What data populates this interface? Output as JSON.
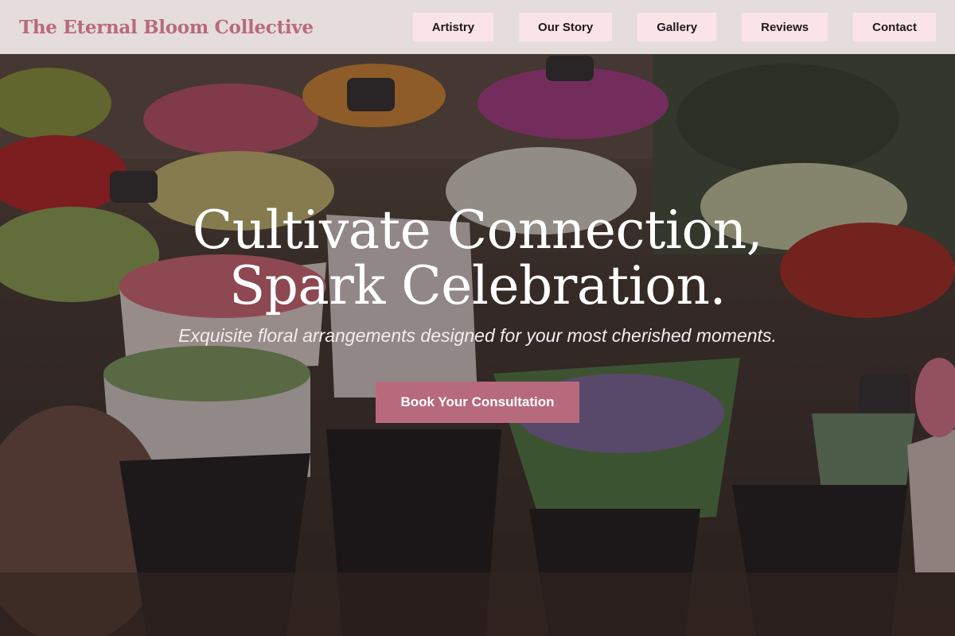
{
  "brand": {
    "name": "The Eternal Bloom Collective"
  },
  "nav": {
    "items": [
      {
        "label": "Artistry"
      },
      {
        "label": "Our Story"
      },
      {
        "label": "Gallery"
      },
      {
        "label": "Reviews"
      },
      {
        "label": "Contact"
      }
    ]
  },
  "hero": {
    "headline_line1": "Cultivate Connection,",
    "headline_line2": "Spark Celebration.",
    "subheadline": "Exquisite floral arrangements designed for your most cherished moments.",
    "cta_label": "Book Your Consultation"
  },
  "colors": {
    "accent": "#b86a7d",
    "nav_button_bg": "#fbe4e8",
    "header_bg": "#faf4f2"
  }
}
